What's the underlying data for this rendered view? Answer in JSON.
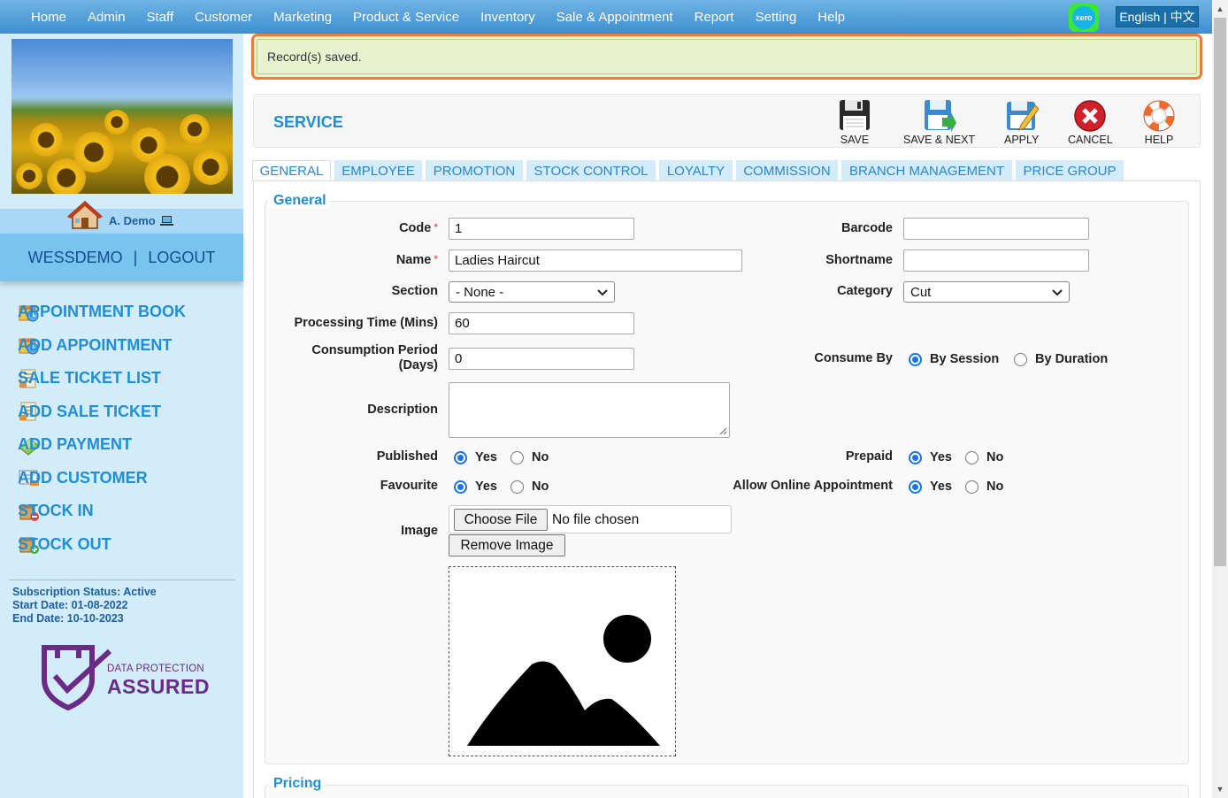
{
  "nav": {
    "items": [
      "Home",
      "Admin",
      "Staff",
      "Customer",
      "Marketing",
      "Product & Service",
      "Inventory",
      "Sale & Appointment",
      "Report",
      "Setting",
      "Help"
    ],
    "xero_label": "xero",
    "language": "English | 中文"
  },
  "sidebar": {
    "user_name": "A. Demo",
    "account": "WESSDEMO",
    "separator": "|",
    "logout": "LOGOUT",
    "menu": [
      {
        "label": "APPOINTMENT BOOK",
        "icon": "calendar-clock-icon"
      },
      {
        "label": "ADD APPOINTMENT",
        "icon": "calendar-clock-icon"
      },
      {
        "label": "SALE TICKET LIST",
        "icon": "receipt-list-icon"
      },
      {
        "label": "ADD SALE TICKET",
        "icon": "receipt-list-icon"
      },
      {
        "label": "ADD PAYMENT",
        "icon": "money-icon"
      },
      {
        "label": "ADD CUSTOMER",
        "icon": "customer-card-icon"
      },
      {
        "label": "STOCK IN",
        "icon": "box-in-icon"
      },
      {
        "label": "STOCK OUT",
        "icon": "box-out-icon"
      }
    ],
    "subscription_status": "Subscription Status: Active",
    "start_date": "Start Date: 01-08-2022",
    "end_date": "End Date: 10-10-2023",
    "dpa_line1": "DATA PROTECTION",
    "dpa_line2": "ASSURED"
  },
  "alert": {
    "message": "Record(s) saved."
  },
  "service": {
    "title": "SERVICE",
    "toolbar": {
      "save": "SAVE",
      "save_next": "SAVE & NEXT",
      "apply": "APPLY",
      "cancel": "CANCEL",
      "help": "HELP"
    }
  },
  "tabs": [
    "GENERAL",
    "EMPLOYEE",
    "PROMOTION",
    "STOCK CONTROL",
    "LOYALTY",
    "COMMISSION",
    "BRANCH MANAGEMENT",
    "PRICE GROUP"
  ],
  "form": {
    "legend": "General",
    "code_label": "Code",
    "code_value": "1",
    "name_label": "Name",
    "name_value": "Ladies Haircut",
    "section_label": "Section",
    "section_value": "- None -",
    "processing_label": "Processing Time (Mins)",
    "processing_value": "60",
    "consumption_label_1": "Consumption Period",
    "consumption_label_2": "(Days)",
    "consumption_value": "0",
    "description_label": "Description",
    "published_label": "Published",
    "favourite_label": "Favourite",
    "image_label": "Image",
    "barcode_label": "Barcode",
    "barcode_value": "",
    "shortname_label": "Shortname",
    "shortname_value": "",
    "category_label": "Category",
    "category_value": "Cut",
    "consume_by_label": "Consume By",
    "by_session": "By Session",
    "by_duration": "By Duration",
    "prepaid_label": "Prepaid",
    "online_label": "Allow Online Appointment",
    "yes": "Yes",
    "no": "No",
    "choose_file": "Choose File",
    "no_file": "No file chosen",
    "remove_image": "Remove Image",
    "required_mark": "*"
  },
  "pricing": {
    "legend": "Pricing"
  }
}
